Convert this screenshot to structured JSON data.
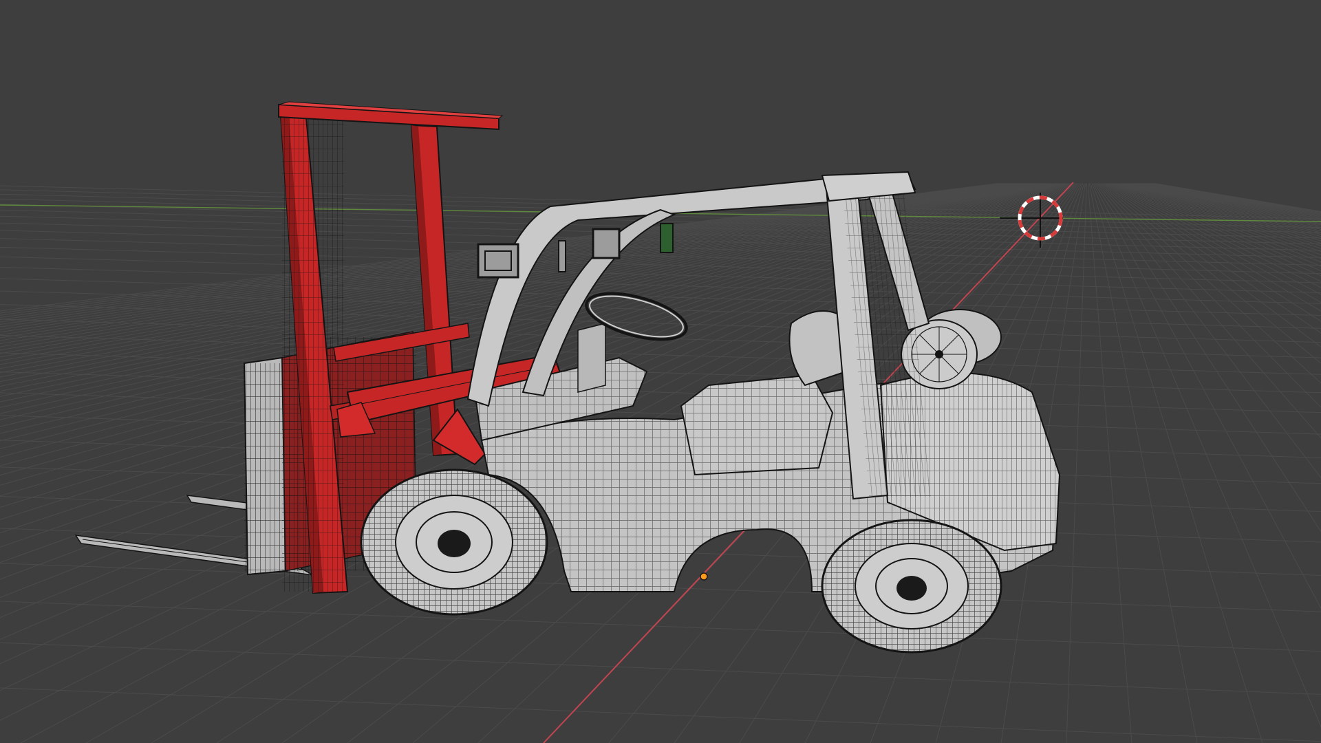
{
  "viewport": {
    "mode": "3d-viewport",
    "shading": "wireframe-overlay",
    "colors": {
      "background": "#3e3e3e",
      "grid_line": "#4b4b4b",
      "grid_line_major": "#555555",
      "x_axis": "#c24450",
      "y_axis": "#5f8a3d",
      "mast": "#c72626",
      "mast_dark": "#8e1a1a",
      "body": "#bdbdbd",
      "wire": "#141414",
      "origin": "#ff9b1a",
      "cursor_red": "#d83a3a",
      "cursor_white": "#ffffff"
    },
    "objects": [
      {
        "name": "forklift-mast",
        "icon": "mesh-icon"
      },
      {
        "name": "forklift-body",
        "icon": "mesh-icon"
      },
      {
        "name": "forklift-wheels",
        "icon": "mesh-icon"
      }
    ],
    "cursor_icon": "3d-cursor-icon",
    "origin_icon": "object-origin-icon"
  }
}
